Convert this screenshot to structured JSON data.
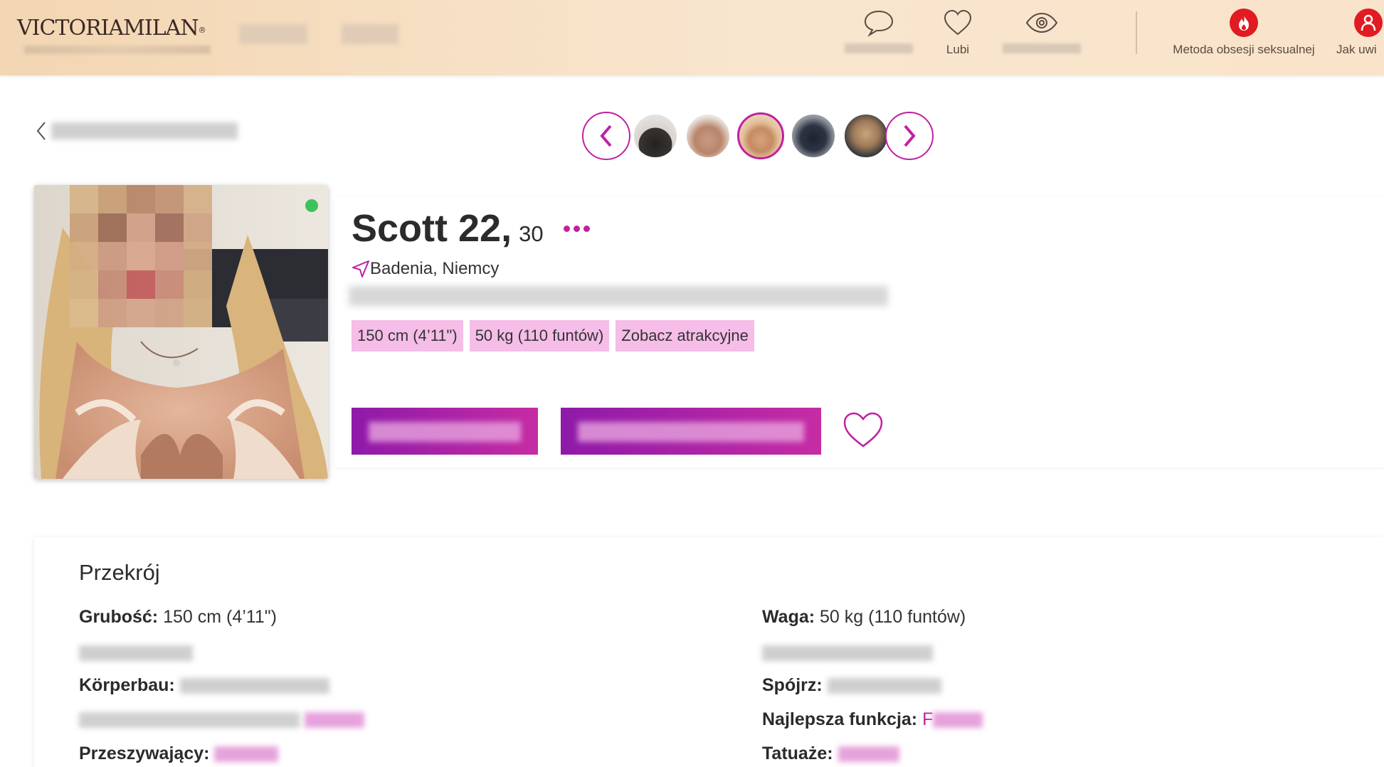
{
  "header": {
    "logo_main": "VICTORIA",
    "logo_second": "MILAN",
    "logo_mark": "®",
    "nav": {
      "likes_label": "Lubi",
      "sexual_method_label": "Metoda obsesji seksualnej",
      "cut_label": "Jak uwi"
    }
  },
  "icons": {
    "messages": "chat-bubble-icon",
    "likes": "heart-icon",
    "views": "eye-icon",
    "flame": "flame-icon",
    "person": "person-icon",
    "back": "chevron-left-icon",
    "prev": "chevron-left-icon",
    "next": "chevron-right-icon",
    "location": "navigation-arrow-icon",
    "more": "more-dots-icon",
    "favorite": "heart-outline-icon"
  },
  "profile": {
    "name": "Scott 22,",
    "age": "30",
    "location": "Badenia, Niemcy",
    "tags": [
      "150 cm (4’11\")",
      "50 kg (110 funtów)",
      "Zobacz atrakcyjne"
    ],
    "online": true
  },
  "details": {
    "title": "Przekrój",
    "left": {
      "thickness_label": "Grubość:",
      "thickness_value": "150 cm (4’11\")",
      "build_label": "Körperbau:",
      "pierce_label": "Przeszywający:"
    },
    "right": {
      "weight_label": "Waga:",
      "weight_value": "50 kg (110 funtów)",
      "look_label": "Spójrz:",
      "best_feature_label": "Najlepsza funkcja:",
      "best_feature_value": "F",
      "tattoo_label": "Tatuaże:"
    }
  },
  "colors": {
    "accent": "#c021a0",
    "tag_bg": "#f5bde8",
    "online": "#3ec35c",
    "header_bg": "#f6dcbf",
    "alert_red": "#e11b22"
  }
}
